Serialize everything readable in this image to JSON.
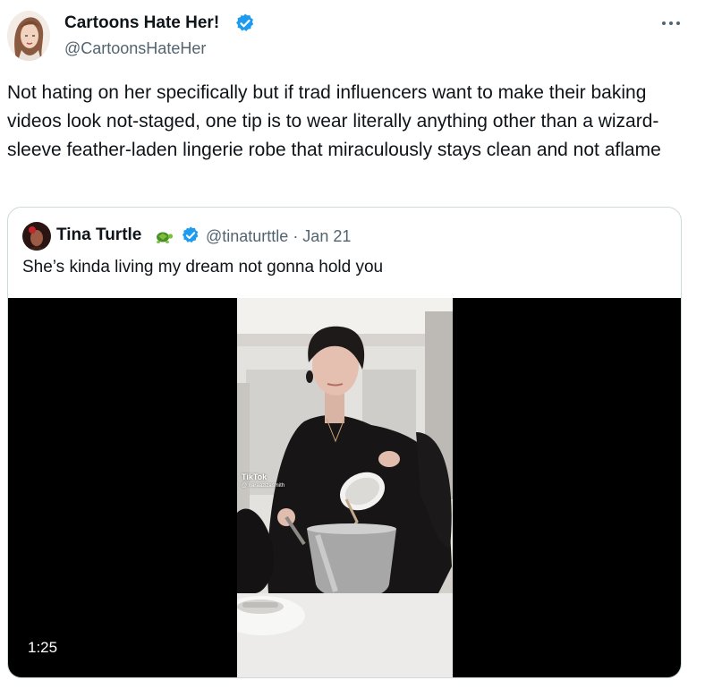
{
  "post": {
    "author_name": "Cartoons Hate Her!",
    "author_handle": "@CartoonsHateHer",
    "more_icon": "more-horizontal-icon",
    "text": "Not hating on her specifically but if trad influencers want to make their baking videos look not-staged, one tip is to wear literally anything other than a wizard-sleeve feather-laden lingerie robe that miraculously stays clean and not aflame"
  },
  "quoted_post": {
    "author_name": "Tina Turtle",
    "emoji_icon": "turtle-icon",
    "handle_and_date": "@tinaturttle · Jan 21",
    "text": "She’s kinda living my dream not gonna hold you",
    "media": {
      "duration": "1:25",
      "watermark_brand": "TikTok",
      "watermark_user": "@ naraazizasmith"
    }
  },
  "colors": {
    "verified_blue": "#1d9bf0",
    "secondary_text": "#536471",
    "border": "#cfd9de"
  }
}
